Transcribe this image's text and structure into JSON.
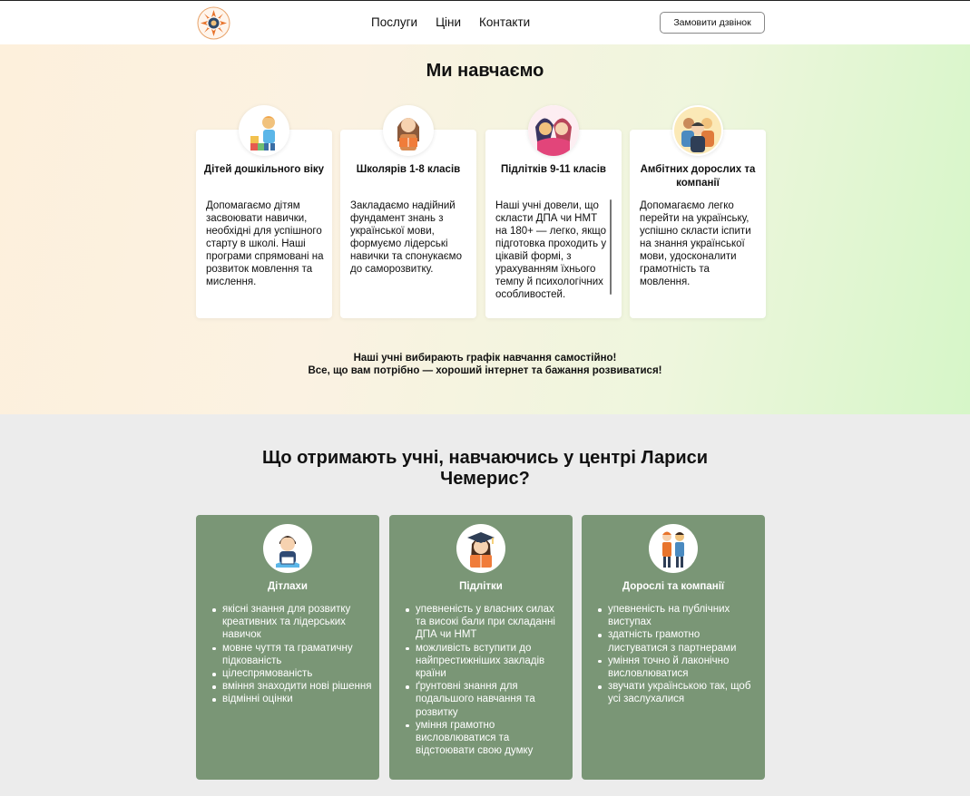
{
  "header": {
    "nav": [
      "Послуги",
      "Ціни",
      "Контакти"
    ],
    "call_button": "Замовити дзвінок"
  },
  "hero": {
    "title": "Ми навчаємо",
    "cards": [
      {
        "title": "Дітей дошкільного віку",
        "text": "Допомагаємо дітям засвоювати навички, необхідні для успішного старту в школі. Наші програми спрямовані на розвиток мовлення та мислення."
      },
      {
        "title": "Школярів 1-8 класів",
        "text": "Закладаємо надійний фундамент знань з української мови, формуємо лідерські навички та спонукаємо до саморозвитку."
      },
      {
        "title": "Підлітків 9-11 класів",
        "text": "Наші учні довели, що скласти ДПА чи НМТ на 180+ — легко, якщо підготовка проходить у цікавій формі, з урахуванням їхнього темпу й психологічних особливостей."
      },
      {
        "title": "Амбітних дорослих та компанії",
        "text": "Допомагаємо легко перейти на українську, успішно скласти іспити на знання української мови, удосконалити грамотність та мовлення."
      }
    ],
    "note_line1": "Наші учні вибирають графік навчання самостійно!",
    "note_line2": "Все, що вам потрібно — хороший інтернет та бажання розвиватися!"
  },
  "benefits": {
    "title": "Що отримають учні, навчаючись у центрі Лариси Чемерис?",
    "cards": [
      {
        "title": "Дітлахи",
        "items": [
          "якісні знання для розвитку креативних та лідерських навичок",
          "мовне чуття та граматичну підкованість",
          "цілеспрямованість",
          "вміння знаходити нові рішення",
          "відмінні оцінки"
        ]
      },
      {
        "title": "Підлітки",
        "items": [
          "упевненість у власних силах та високі бали при складанні ДПА чи НМТ",
          "можливість вступити до найпрестижніших закладів країни",
          "ґрунтовні знання для подальшого навчання та розвитку",
          "уміння грамотно висловлюватися та відстоювати свою думку"
        ]
      },
      {
        "title": "Дорослі та компанії",
        "items": [
          "упевненість на публічних виступах",
          "здатність грамотно листуватися з партнерами",
          "уміння точно й лаконічно висловлюватися",
          "звучати українською так, щоб усі заслухалися"
        ]
      }
    ]
  },
  "colors": {
    "card_green": "#7a9676",
    "section_gray": "#ececec",
    "logo_orange": "#e8742c"
  }
}
